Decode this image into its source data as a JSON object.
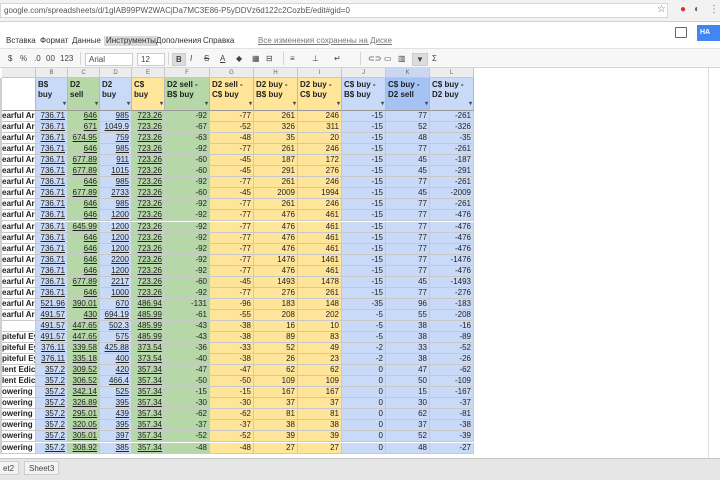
{
  "browser": {
    "url": "google.com/spreadsheets/d/1gIAB99PW2WACjDa7MC3E86-P5yDDVz6d122c2CozbE/edit#gid=0"
  },
  "menu": {
    "items": [
      "Вставка",
      "Формат",
      "Данные",
      "Инструменты",
      "Дополнения",
      "Справка"
    ],
    "active": "Инструменты",
    "save_status": "Все изменения сохранены на Диске",
    "share_label": "НА"
  },
  "toolbar": {
    "items": [
      "$",
      "%",
      ".0",
      "00",
      "123",
      "Arial",
      "12",
      "B",
      "I",
      "S",
      "A"
    ]
  },
  "columns": {
    "letters": [
      "B",
      "C",
      "D",
      "E",
      "F",
      "G",
      "H",
      "I",
      "J",
      "K",
      "L"
    ],
    "selected": "K"
  },
  "headers": [
    "B$\nbuy",
    "D2\nsell",
    "D2\nbuy",
    "C$\nbuy",
    "D2 sell -\nB$ buy",
    "D2 sell -\nC$ buy",
    "D2 buy -\nB$ buy",
    "D2 buy -\nC$ buy",
    "C$ buy -\nB$ buy",
    "C$ buy -\nD2 sell",
    "C$ buy -\nD2 buy"
  ],
  "names": [
    "earful Aria",
    "earful Aria",
    "earful Aria",
    "earful Aria",
    "earful Aria",
    "earful Aria",
    "earful Aria",
    "earful Aria",
    "earful Aria",
    "earful Aria",
    "earful Aria",
    "earful Aria",
    "earful Aria",
    "earful Aria",
    "earful Aria",
    "earful Aria",
    "earful Aria",
    "earful Aria",
    "earful Aria",
    "",
    "piteful Ey",
    "piteful Ey",
    "piteful Ey",
    "lent Edic",
    "lent Edic",
    "owering S",
    "owering S",
    "owering S",
    "owering S",
    "owering S",
    "owering S",
    "owering S",
    "owering S",
    ""
  ],
  "rows": [
    [
      "736.71",
      "646",
      "985",
      "723.26",
      "-92",
      "-77",
      "261",
      "246",
      "-15",
      "77",
      "-261"
    ],
    [
      "736.71",
      "671",
      "1049.9",
      "723.26",
      "-67",
      "-52",
      "326",
      "311",
      "-15",
      "52",
      "-326"
    ],
    [
      "736.71",
      "674.95",
      "759",
      "723.26",
      "-63",
      "-48",
      "35",
      "20",
      "-15",
      "48",
      "-35"
    ],
    [
      "736.71",
      "646",
      "985",
      "723.26",
      "-92",
      "-77",
      "261",
      "246",
      "-15",
      "77",
      "-261"
    ],
    [
      "736.71",
      "677.89",
      "911",
      "723.26",
      "-60",
      "-45",
      "187",
      "172",
      "-15",
      "45",
      "-187"
    ],
    [
      "736.71",
      "677.89",
      "1015",
      "723.26",
      "-60",
      "-45",
      "291",
      "276",
      "-15",
      "45",
      "-291"
    ],
    [
      "736.71",
      "646",
      "985",
      "723.26",
      "-92",
      "-77",
      "261",
      "246",
      "-15",
      "77",
      "-261"
    ],
    [
      "736.71",
      "677.89",
      "2733",
      "723.26",
      "-60",
      "-45",
      "2009",
      "1994",
      "-15",
      "45",
      "-2009"
    ],
    [
      "736.71",
      "646",
      "985",
      "723.26",
      "-92",
      "-77",
      "261",
      "246",
      "-15",
      "77",
      "-261"
    ],
    [
      "736.71",
      "646",
      "1200",
      "723.26",
      "-92",
      "-77",
      "476",
      "461",
      "-15",
      "77",
      "-476"
    ],
    [
      "736.71",
      "645.99",
      "1200",
      "723.26",
      "-92",
      "-77",
      "476",
      "461",
      "-15",
      "77",
      "-476"
    ],
    [
      "736.71",
      "646",
      "1200",
      "723.26",
      "-92",
      "-77",
      "476",
      "461",
      "-15",
      "77",
      "-476"
    ],
    [
      "736.71",
      "646",
      "1200",
      "723.26",
      "-92",
      "-77",
      "476",
      "461",
      "-15",
      "77",
      "-476"
    ],
    [
      "736.71",
      "646",
      "2200",
      "723.26",
      "-92",
      "-77",
      "1476",
      "1461",
      "-15",
      "77",
      "-1476"
    ],
    [
      "736.71",
      "646",
      "1200",
      "723.26",
      "-92",
      "-77",
      "476",
      "461",
      "-15",
      "77",
      "-476"
    ],
    [
      "736.71",
      "677.89",
      "2217",
      "723.26",
      "-60",
      "-45",
      "1493",
      "1478",
      "-15",
      "45",
      "-1493"
    ],
    [
      "736.71",
      "646",
      "1000",
      "723.26",
      "-92",
      "-77",
      "276",
      "261",
      "-15",
      "77",
      "-276"
    ],
    [
      "521.96",
      "390.01",
      "670",
      "486.94",
      "-131",
      "-96",
      "183",
      "148",
      "-35",
      "96",
      "-183"
    ],
    [
      "491.57",
      "430",
      "694.19",
      "485.99",
      "-61",
      "-55",
      "208",
      "202",
      "-5",
      "55",
      "-208"
    ],
    [
      "491.57",
      "447.65",
      "502.3",
      "485.99",
      "-43",
      "-38",
      "16",
      "10",
      "-5",
      "38",
      "-16"
    ],
    [
      "491.57",
      "447.65",
      "575",
      "485.99",
      "-43",
      "-38",
      "89",
      "83",
      "-5",
      "38",
      "-89"
    ],
    [
      "376.11",
      "339.58",
      "425.88",
      "373.54",
      "-36",
      "-33",
      "52",
      "49",
      "-2",
      "33",
      "-52"
    ],
    [
      "376.11",
      "335.18",
      "400",
      "373.54",
      "-40",
      "-38",
      "26",
      "23",
      "-2",
      "38",
      "-26"
    ],
    [
      "357.2",
      "309.52",
      "420",
      "357.34",
      "-47",
      "-47",
      "62",
      "62",
      "0",
      "47",
      "-62"
    ],
    [
      "357.2",
      "306.52",
      "466.4",
      "357.34",
      "-50",
      "-50",
      "109",
      "109",
      "0",
      "50",
      "-109"
    ],
    [
      "357.2",
      "342.14",
      "525",
      "357.34",
      "-15",
      "-15",
      "167",
      "167",
      "0",
      "15",
      "-167"
    ],
    [
      "357.2",
      "326.89",
      "395",
      "357.34",
      "-30",
      "-30",
      "37",
      "37",
      "0",
      "30",
      "-37"
    ],
    [
      "357.2",
      "295.01",
      "439",
      "357.34",
      "-62",
      "-62",
      "81",
      "81",
      "0",
      "62",
      "-81"
    ],
    [
      "357.2",
      "320.05",
      "395",
      "357.34",
      "-37",
      "-37",
      "38",
      "38",
      "0",
      "37",
      "-38"
    ],
    [
      "357.2",
      "305.01",
      "397",
      "357.34",
      "-52",
      "-52",
      "39",
      "39",
      "0",
      "52",
      "-39"
    ],
    [
      "357.2",
      "308.92",
      "385",
      "357.34",
      "-48",
      "-48",
      "27",
      "27",
      "0",
      "48",
      "-27"
    ]
  ],
  "sheets": [
    "et2",
    "Sheet3"
  ],
  "colors": {
    "blue": "#c9daf8",
    "green": "#b6d7a8",
    "yellow": "#ffe599",
    "bluehdr": "#a4c2f4"
  }
}
